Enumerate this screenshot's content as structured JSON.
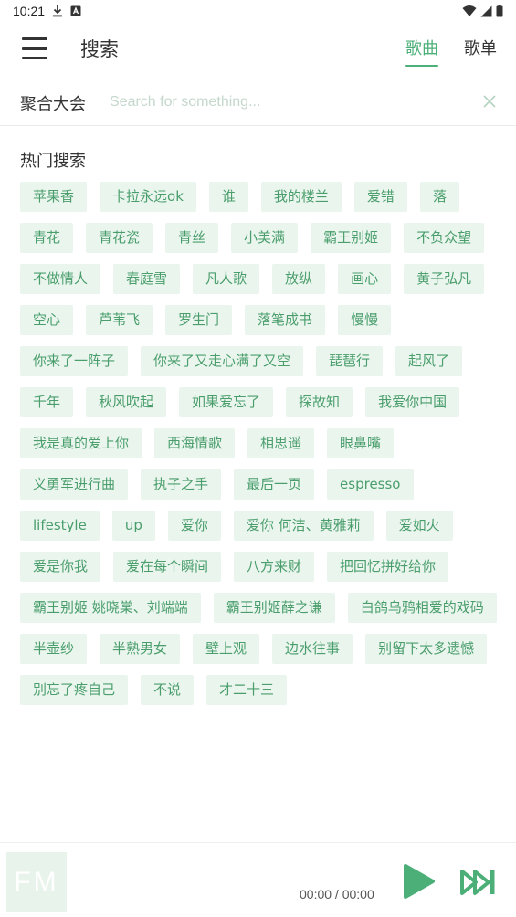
{
  "status_bar": {
    "time": "10:21",
    "icons": [
      "download-icon",
      "notification-a-icon",
      "wifi-icon",
      "signal-icon",
      "battery-icon"
    ]
  },
  "app_bar": {
    "title": "搜索",
    "tabs": [
      {
        "label": "歌曲",
        "active": true
      },
      {
        "label": "歌单",
        "active": false
      }
    ]
  },
  "search": {
    "source_label": "聚合大会",
    "placeholder": "Search for something..."
  },
  "hot_search": {
    "title": "热门搜索",
    "tags": [
      "苹果香",
      "卡拉永远ok",
      "谁",
      "我的楼兰",
      "爱错",
      "落",
      "青花",
      "青花瓷",
      "青丝",
      "小美满",
      "霸王别姬",
      "不负众望",
      "不做情人",
      "春庭雪",
      "凡人歌",
      "放纵",
      "画心",
      "黄子弘凡",
      "空心",
      "芦苇飞",
      "罗生门",
      "落笔成书",
      "慢慢",
      "你来了一阵子",
      "你来了又走心满了又空",
      "琵琶行",
      "起风了",
      "千年",
      "秋风吹起",
      "如果爱忘了",
      "探故知",
      "我爱你中国",
      "我是真的爱上你",
      "西海情歌",
      "相思遥",
      "眼鼻嘴",
      "义勇军进行曲",
      "执子之手",
      "最后一页",
      "espresso",
      "lifestyle",
      "up",
      "爱你",
      "爱你 何洁、黄雅莉",
      "爱如火",
      "爱是你我",
      "爱在每个瞬间",
      "八方来财",
      "把回忆拼好给你",
      "霸王别姬 姚晓棠、刘端端",
      "霸王别姬薛之谦",
      "白鸽乌鸦相爱的戏码",
      "半壶纱",
      "半熟男女",
      "壁上观",
      "边水往事",
      "别留下太多遗憾",
      "别忘了疼自己",
      "不说",
      "才二十三"
    ]
  },
  "player": {
    "cover_text": "FM",
    "time": "00:00 / 00:00"
  },
  "colors": {
    "accent": "#4caf78",
    "tag_bg": "#eaf5ee",
    "tag_text": "#4a9e6c"
  }
}
